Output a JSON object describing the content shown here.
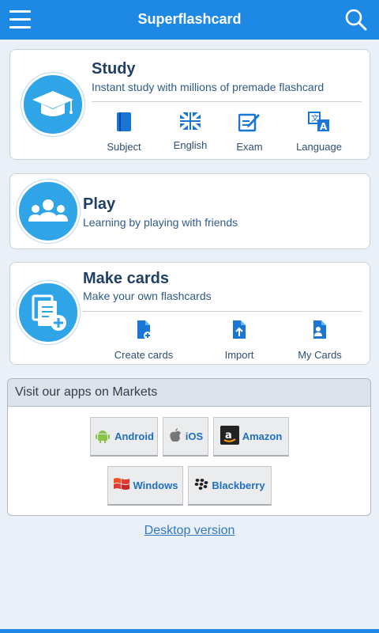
{
  "header": {
    "title": "Superflashcard",
    "menu_icon": "hamburger-menu-icon",
    "search_icon": "search-icon",
    "color": "#1e88e5"
  },
  "study": {
    "title": "Study",
    "subtitle": "Instant study with millions of premade flashcard",
    "items": [
      {
        "label": "Subject",
        "icon": "book-icon"
      },
      {
        "label": "English",
        "icon": "uk-flag-icon"
      },
      {
        "label": "Exam",
        "icon": "pencil-paper-icon"
      },
      {
        "label": "Language",
        "icon": "translate-icon"
      }
    ]
  },
  "play": {
    "title": "Play",
    "subtitle": "Learning by playing with friends"
  },
  "make": {
    "title": "Make cards",
    "subtitle": "Make your own flashcards",
    "items": [
      {
        "label": "Create cards",
        "icon": "add-document-icon"
      },
      {
        "label": "Import",
        "icon": "upload-document-icon"
      },
      {
        "label": "My Cards",
        "icon": "user-document-icon"
      }
    ]
  },
  "markets": {
    "title": "Visit our apps on Markets",
    "buttons": [
      "Android",
      "iOS",
      "Amazon",
      "Windows",
      "Blackberry"
    ]
  },
  "footer": {
    "desktop_link": "Desktop version"
  }
}
